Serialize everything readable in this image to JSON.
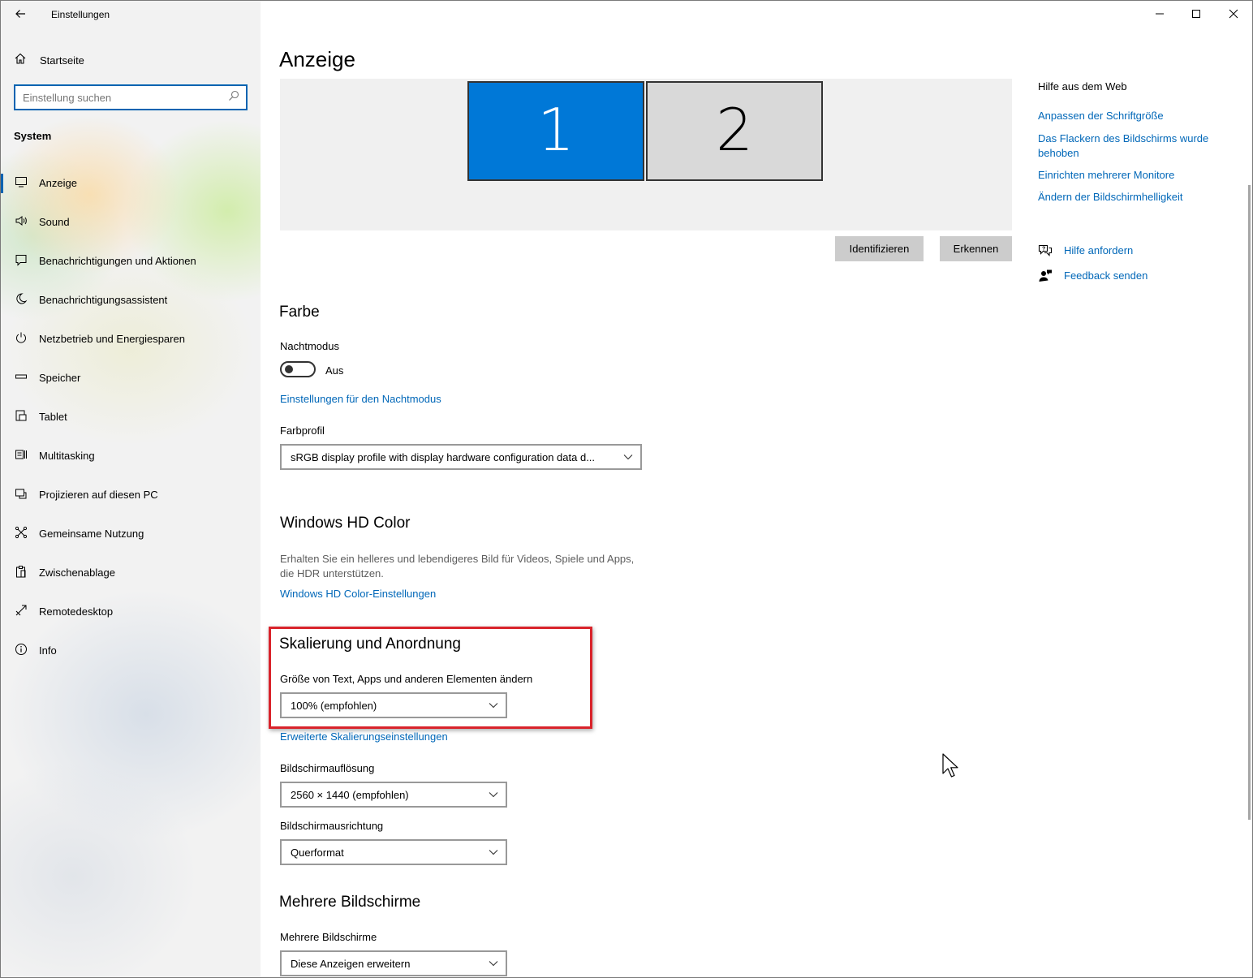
{
  "window": {
    "title": "Einstellungen",
    "controls": [
      "minimize-icon",
      "maximize-icon",
      "close-icon"
    ]
  },
  "sidebar": {
    "home_label": "Startseite",
    "search_placeholder": "Einstellung suchen",
    "section": "System",
    "items": [
      {
        "label": "Anzeige",
        "icon": "monitor-icon",
        "active": true
      },
      {
        "label": "Sound",
        "icon": "speaker-icon"
      },
      {
        "label": "Benachrichtigungen und Aktionen",
        "icon": "notification-icon"
      },
      {
        "label": "Benachrichtigungsassistent",
        "icon": "moon-icon"
      },
      {
        "label": "Netzbetrieb und Energiesparen",
        "icon": "power-icon"
      },
      {
        "label": "Speicher",
        "icon": "storage-icon"
      },
      {
        "label": "Tablet",
        "icon": "tablet-icon"
      },
      {
        "label": "Multitasking",
        "icon": "multitasking-icon"
      },
      {
        "label": "Projizieren auf diesen PC",
        "icon": "project-icon"
      },
      {
        "label": "Gemeinsame Nutzung",
        "icon": "share-icon"
      },
      {
        "label": "Zwischenablage",
        "icon": "clipboard-icon"
      },
      {
        "label": "Remotedesktop",
        "icon": "remote-icon"
      },
      {
        "label": "Info",
        "icon": "info-icon"
      }
    ]
  },
  "main": {
    "title": "Anzeige",
    "monitors": [
      "1",
      "2"
    ],
    "identify_label": "Identifizieren",
    "detect_label": "Erkennen",
    "color": {
      "heading": "Farbe",
      "night_mode_label": "Nachtmodus",
      "night_mode_state": "Aus",
      "night_mode_settings_link": "Einstellungen für den Nachtmodus",
      "profile_label": "Farbprofil",
      "profile_value": "sRGB display profile with display hardware configuration data d..."
    },
    "hd_color": {
      "heading": "Windows HD Color",
      "description": "Erhalten Sie ein helleres und lebendigeres Bild für Videos, Spiele und Apps, die HDR unterstützen.",
      "link": "Windows HD Color-Einstellungen"
    },
    "scaling": {
      "heading": "Skalierung und Anordnung",
      "size_label": "Größe von Text, Apps und anderen Elementen ändern",
      "size_value": "100% (empfohlen)",
      "advanced_link": "Erweiterte Skalierungseinstellungen",
      "resolution_label": "Bildschirmauflösung",
      "resolution_value": "2560 × 1440 (empfohlen)",
      "orientation_label": "Bildschirmausrichtung",
      "orientation_value": "Querformat"
    },
    "multi": {
      "heading": "Mehrere Bildschirme",
      "label": "Mehrere Bildschirme",
      "value": "Diese Anzeigen erweitern"
    }
  },
  "help": {
    "heading": "Hilfe aus dem Web",
    "links": [
      "Anpassen der Schriftgröße",
      "Das Flackern des Bildschirms wurde behoben",
      "Einrichten mehrerer Monitore",
      "Ändern der Bildschirmhelligkeit"
    ],
    "get_help": "Hilfe anfordern",
    "feedback": "Feedback senden"
  },
  "colors": {
    "accent": "#0078d7",
    "link": "#0067b8",
    "highlight": "#d9232b"
  }
}
